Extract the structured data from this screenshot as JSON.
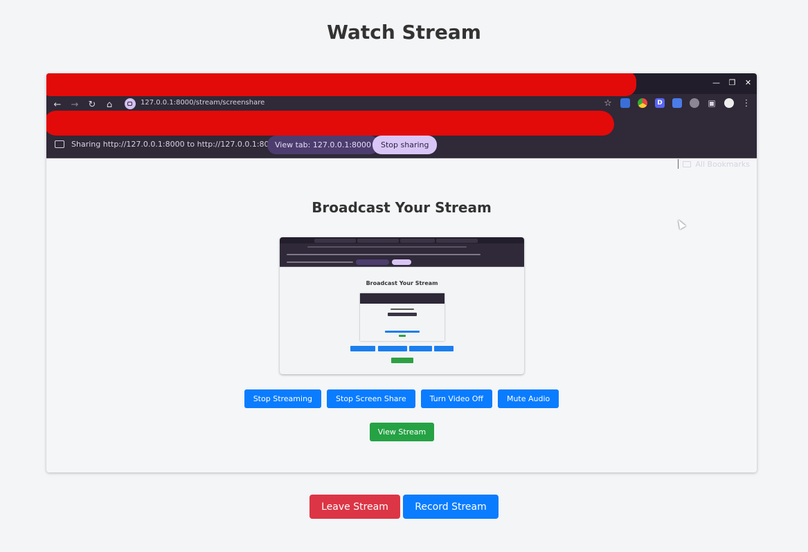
{
  "page": {
    "title": "Watch Stream"
  },
  "captured_browser": {
    "url": "127.0.0.1:8000/stream/screenshare",
    "bookmarks_label": "All Bookmarks",
    "share_text": "Sharing http://127.0.0.1:8000 to http://127.0.0.1:8000",
    "view_tab_label": "View tab: 127.0.0.1:8000",
    "stop_sharing_label": "Stop sharing",
    "window_controls": [
      "minimize-icon",
      "restore-icon",
      "close-icon"
    ],
    "nav_icons": [
      "back-icon",
      "forward-icon",
      "reload-icon",
      "home-icon"
    ],
    "extension_icons": [
      "star-icon",
      "extension-1-icon",
      "chrome-icon",
      "d-icon",
      "translate-icon",
      "extension-2-icon",
      "puzzle-icon",
      "profile-icon",
      "more-icon"
    ],
    "broadcast_title": "Broadcast Your Stream",
    "preview_title": "Broadcast Your Stream",
    "buttons": {
      "stop_streaming": "Stop Streaming",
      "stop_screen_share": "Stop Screen Share",
      "turn_video_off": "Turn Video Off",
      "mute_audio": "Mute Audio",
      "view_stream": "View Stream"
    }
  },
  "controls": {
    "leave_stream": "Leave Stream",
    "record_stream": "Record Stream"
  },
  "colors": {
    "primary_blue": "#0a7cff",
    "success_green": "#25a244",
    "danger_red": "#dc3545",
    "redaction_red": "#e30a0a"
  }
}
